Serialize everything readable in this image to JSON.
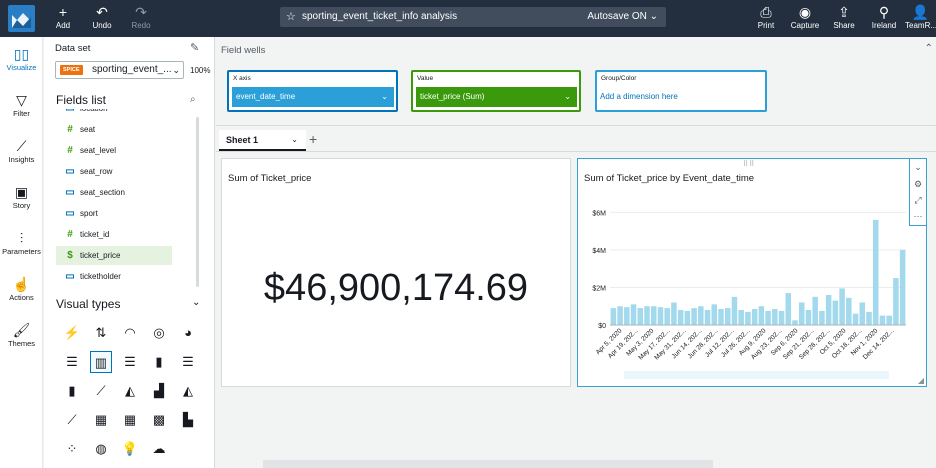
{
  "topbar": {
    "add": "Add",
    "undo": "Undo",
    "redo": "Redo",
    "analysis_title": "sporting_event_ticket_info analysis",
    "autosave": "Autosave ON",
    "print": "Print",
    "capture": "Capture",
    "share": "Share",
    "region": "Ireland",
    "team": "TeamR..."
  },
  "nav": {
    "visualize": "Visualize",
    "filter": "Filter",
    "insights": "Insights",
    "story": "Story",
    "parameters": "Parameters",
    "actions": "Actions",
    "themes": "Themes"
  },
  "dataset": {
    "label": "Data set",
    "badge": "SPICE",
    "name": "sporting_event_...",
    "percent": "100%"
  },
  "fields": {
    "title": "Fields list",
    "items": [
      {
        "name": "location",
        "type": "geo"
      },
      {
        "name": "seat",
        "type": "#"
      },
      {
        "name": "seat_level",
        "type": "#"
      },
      {
        "name": "seat_row",
        "type": "text"
      },
      {
        "name": "seat_section",
        "type": "text"
      },
      {
        "name": "sport",
        "type": "text"
      },
      {
        "name": "ticket_id",
        "type": "#"
      },
      {
        "name": "ticket_price",
        "type": "$"
      },
      {
        "name": "ticketholder",
        "type": "text"
      }
    ]
  },
  "visual_types": {
    "title": "Visual types"
  },
  "fieldwells": {
    "title": "Field wells",
    "xaxis": {
      "label": "X axis",
      "value": "event_date_time"
    },
    "value": {
      "label": "Value",
      "value": "ticket_price (Sum)"
    },
    "group": {
      "label": "Group/Color",
      "add": "Add a dimension here"
    }
  },
  "sheet": {
    "tab": "Sheet 1"
  },
  "kpi": {
    "title": "Sum of Ticket_price",
    "value": "$46,900,174.69"
  },
  "colors": {
    "accent": "#0073bb",
    "green": "#3b9a0b",
    "bar": "#a3d9ec",
    "topbar": "#232f3e"
  },
  "chart_data": {
    "type": "bar",
    "title": "Sum of Ticket_price by Event_date_time",
    "xlabel": "",
    "ylabel": "",
    "ylim": [
      0,
      6.5
    ],
    "y_unit": "M",
    "yticks": [
      "$0",
      "$2M",
      "$4M",
      "$6M"
    ],
    "ytick_values": [
      0,
      2,
      4,
      6
    ],
    "tick_labels": [
      "Apr 5, 2020",
      "Apr 19, 202...",
      "May 3, 2020",
      "May 17, 202...",
      "May 31, 202...",
      "Jun 14, 202...",
      "Jun 28, 202...",
      "Jul 12, 202...",
      "Jul 26, 202...",
      "Aug 9, 2020",
      "Aug 23, 202...",
      "Sep 6, 2020",
      "Sep 21, 202...",
      "Sep 28, 202...",
      "Oct 5, 2020",
      "Oct 18, 202...",
      "Nov 1, 2020",
      "Dec 14, 202..."
    ],
    "values": [
      0.9,
      1.0,
      0.95,
      1.1,
      0.9,
      1.0,
      1.0,
      0.95,
      0.9,
      1.2,
      0.8,
      0.75,
      0.9,
      1.0,
      0.8,
      1.1,
      0.85,
      0.9,
      1.5,
      0.8,
      0.7,
      0.85,
      1.0,
      0.75,
      0.85,
      0.75,
      1.7,
      0.25,
      1.2,
      0.8,
      1.5,
      0.75,
      1.6,
      1.3,
      1.95,
      1.45,
      0.6,
      1.2,
      0.7,
      5.6,
      0.5,
      0.5,
      2.5,
      4.0
    ]
  }
}
